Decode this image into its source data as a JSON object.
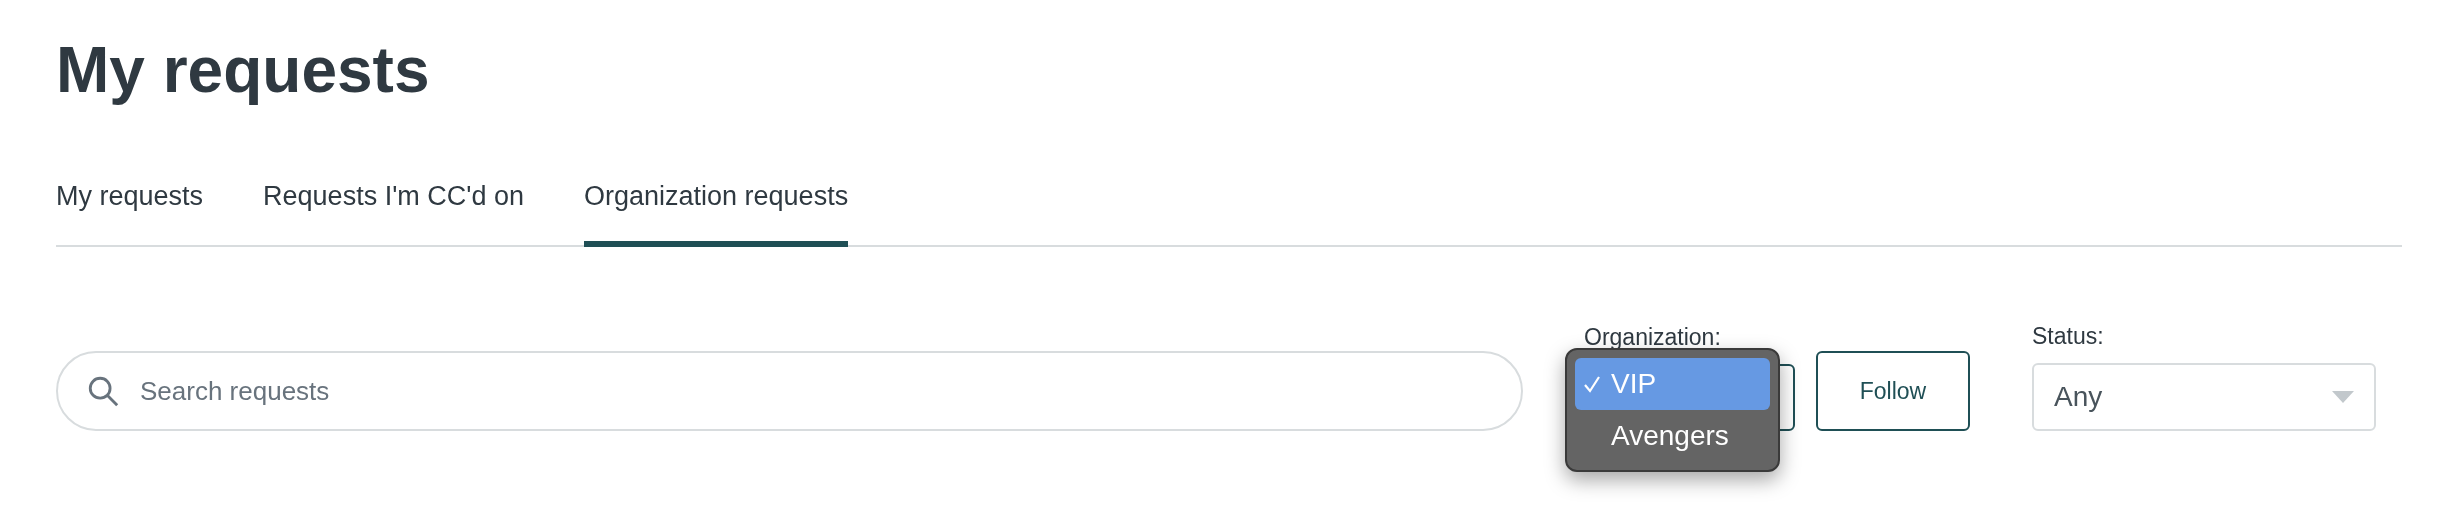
{
  "title": "My requests",
  "tabs": [
    {
      "label": "My requests",
      "selected": false
    },
    {
      "label": "Requests I'm CC'd on",
      "selected": false
    },
    {
      "label": "Organization requests",
      "selected": true
    }
  ],
  "search": {
    "placeholder": "Search requests"
  },
  "organization": {
    "label": "Organization:",
    "menu": [
      {
        "label": "VIP",
        "selected": true
      },
      {
        "label": "Avengers",
        "selected": false
      }
    ]
  },
  "follow_button": "Follow",
  "status": {
    "label": "Status:",
    "value": "Any"
  }
}
